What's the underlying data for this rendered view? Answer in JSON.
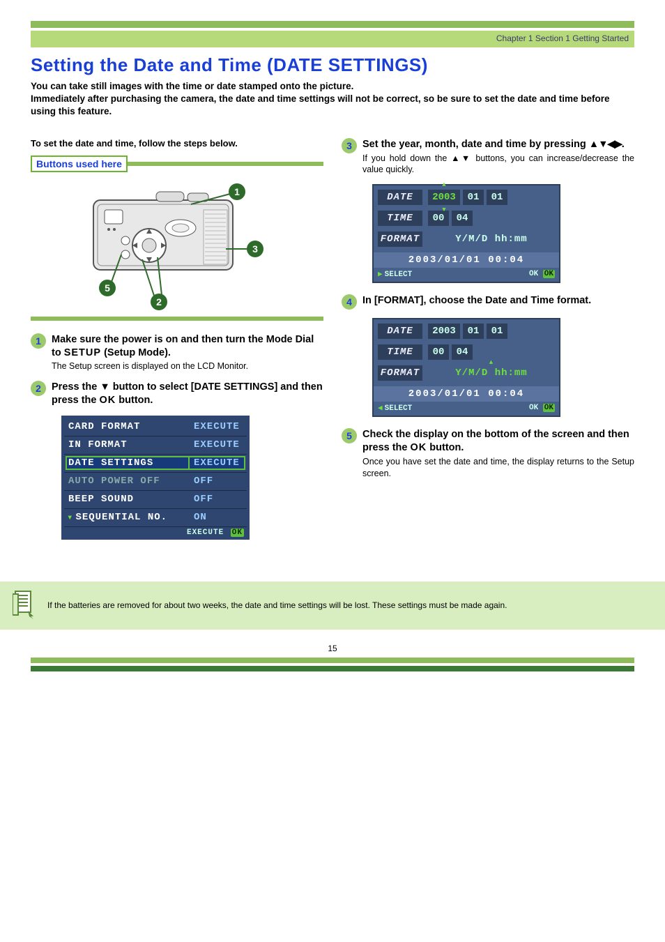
{
  "breadcrumb": "Chapter 1 Section 1 Getting Started",
  "title": "Setting the Date and Time (DATE SETTINGS)",
  "intro": "You can take still images with the time or date stamped onto the picture.\nImmediately after purchasing the camera, the date and time settings will not be correct, so be sure to set the date and time before using this feature.",
  "left": {
    "lead": "To set the date and time, follow the steps below.",
    "buttons_used_label": "Buttons used here",
    "callouts": {
      "c1": "1",
      "c2": "2",
      "c3": "3",
      "c5": "5"
    },
    "step1": {
      "num": "1",
      "title_a": "Make sure the power is on and then turn the Mode Dial to ",
      "title_setup": "SETUP",
      "title_b": " (Setup Mode).",
      "desc": "The Setup screen is displayed on the LCD Monitor."
    },
    "step2": {
      "num": "2",
      "title_a": "Press the ",
      "arrow": "▼",
      "title_b": " button to select  [DATE SETTINGS] and then press the ",
      "ok": "OK",
      "title_c": " button."
    },
    "menu": {
      "rows": [
        {
          "label": "CARD FORMAT",
          "value": "EXECUTE",
          "sel": false,
          "dim": false
        },
        {
          "label": "IN FORMAT",
          "value": "EXECUTE",
          "sel": false,
          "dim": false
        },
        {
          "label": "DATE SETTINGS",
          "value": "EXECUTE",
          "sel": true,
          "dim": false
        },
        {
          "label": "AUTO POWER OFF",
          "value": "OFF",
          "sel": false,
          "dim": true
        },
        {
          "label": "BEEP SOUND",
          "value": "OFF",
          "sel": false,
          "dim": false
        },
        {
          "label": "SEQUENTIAL NO.",
          "value": "ON",
          "sel": false,
          "dim": false
        }
      ],
      "foot_text": "EXECUTE",
      "foot_ok": "OK"
    }
  },
  "right": {
    "step3": {
      "num": "3",
      "title_a": "Set the year, month, date and time by pressing ",
      "arrows": "▲▼◀▶",
      "title_b": ".",
      "desc_a": "If you hold down the ",
      "desc_arrows": "▲▼",
      "desc_b": " buttons, you can increase/decrease the value quickly."
    },
    "ds1": {
      "date_label": "DATE",
      "year": "2003",
      "month": "01",
      "day": "01",
      "time_label": "TIME",
      "hour": "00",
      "min": "04",
      "format_label": "FORMAT",
      "format_value": "Y/M/D hh:mm",
      "preview": "2003/01/01 00:04",
      "select": "SELECT",
      "ok": "OK",
      "okword": "OK"
    },
    "step4": {
      "num": "4",
      "title": "In [FORMAT], choose the Date and Time format."
    },
    "ds2": {
      "date_label": "DATE",
      "year": "2003",
      "month": "01",
      "day": "01",
      "time_label": "TIME",
      "hour": "00",
      "min": "04",
      "format_label": "FORMAT",
      "format_value": "Y/M/D hh:mm",
      "preview": "2003/01/01 00:04",
      "select": "SELECT",
      "ok": "OK",
      "okword": "OK"
    },
    "step5": {
      "num": "5",
      "title_a": "Check the display on the bottom of the screen and then press the ",
      "ok": "OK",
      "title_b": " button.",
      "desc": "Once you have set the date and time, the display returns to the Setup screen."
    }
  },
  "note": "If the batteries are removed for about two weeks, the date and time settings will be lost. These settings must be made again.",
  "page_number": "15"
}
